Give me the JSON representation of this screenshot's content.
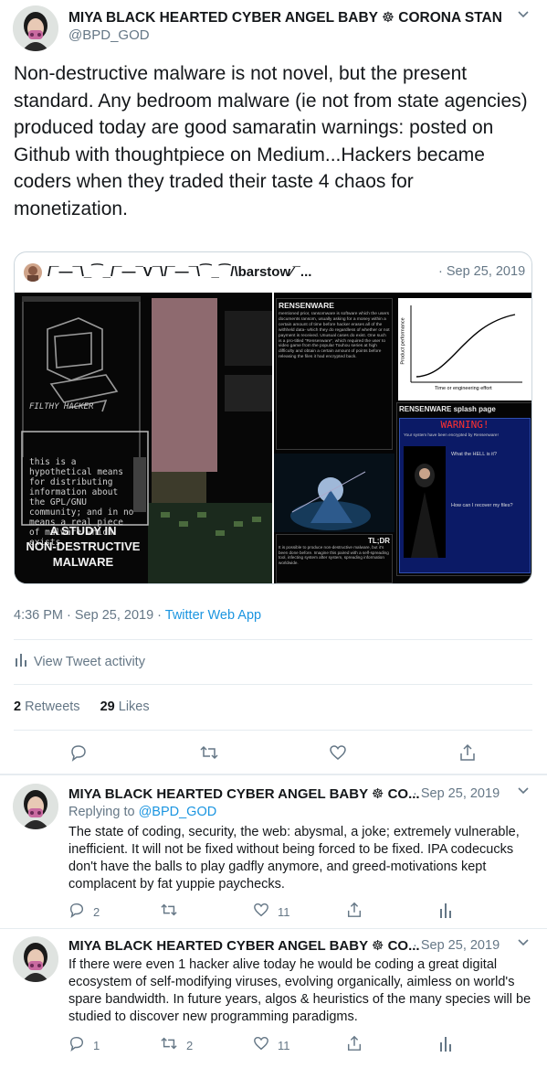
{
  "main_tweet": {
    "author_name": "MIYA BLACK HEARTED CYBER ANGEL BABY ☸ CORONA STAN",
    "author_handle": "@BPD_GOD",
    "text": "Non-destructive malware is not novel, but the present standard. Any bedroom malware (ie not from state agencies) produced today are good samaratin warnings: posted on Github with thoughtpiece on Medium...Hackers became coders when they traded their taste 4 chaos for monetization.",
    "quote": {
      "author_name": "/¯—¯\\_⁀_/¯—¯V¯\\/¯—¯\\⁀_⁀/\\barstow⁄¯...",
      "date": "· Sep 25, 2019",
      "left_image": {
        "label_filthy": "FILTHY HACKER",
        "paragraph": "this is a hypothetical means for distributing information about the GPL/GNU community; and in no means a real piece of malware which exists",
        "heading_line1": "A STUDY IN",
        "heading_line2": "NON-DESTRUCTIVE",
        "heading_line3": "MALWARE"
      },
      "right_image": {
        "section1_title": "RENSENWARE",
        "section1_body": "mentioned prior, ransomware is software which the users documents ransom, usually asking for a money within a certain amount of time before hacker erases all of the withheld data- which they do regardless of whether or not payment is received. Unusual cases do exist. One such is a pro-titled \"Rensenware\", which required the user to video game from the popular Touhou series at high difficulty and obtain a certain amount of points before releasing the files it had encrypted back.",
        "section2_title": "TL;DR",
        "section2_body": "It is possible to produce non-destructive malware, but it's been done before. Imagine this paired with a self-spreading tool, infecting system after system, spreading information worldwide.",
        "chart_caption": "Time or engineering effort",
        "chart_ylabel": "Product performance",
        "splash_title": "RENSENWARE splash page",
        "splash_warning": "WARNING!",
        "splash_line1": "Your system have been encrypted by Rensenware!",
        "splash_line2": "What the HELL is it?",
        "splash_line3": "How can I recover my files?"
      }
    },
    "timestamp": "4:36 PM · Sep 25, 2019 · ",
    "source": "Twitter Web App",
    "activity_label": "View Tweet activity",
    "retweets_count": "2",
    "retweets_label": "Retweets",
    "likes_count": "29",
    "likes_label": "Likes"
  },
  "replies": [
    {
      "author_name": "MIYA BLACK HEARTED CYBER ANGEL BABY ☸ CO...",
      "date": "· Sep 25, 2019",
      "replying_to_label": "Replying to ",
      "replying_to_handle": "@BPD_GOD",
      "text": "The state of coding, security, the web: abysmal, a joke; extremely vulnerable, inefficient. It will not be fixed without being forced to be fixed. IPA codecucks don't have the balls to play gadfly anymore, and greed-motivations kept complacent by fat yuppie paychecks.",
      "reply_count": "2",
      "retweet_count": "",
      "like_count": "11"
    },
    {
      "author_name": "MIYA BLACK HEARTED CYBER ANGEL BABY ☸ CO...",
      "date": "· Sep 25, 2019",
      "text": "If there were even 1 hacker alive today he would be coding a great digital ecosystem of self-modifying viruses, evolving organically, aimless on world's spare bandwidth. In future years, algos & heuristics of the many species will be studied to discover new programming paradigms.",
      "reply_count": "1",
      "retweet_count": "2",
      "like_count": "11"
    }
  ],
  "colors": {
    "accent": "#1b95e0",
    "muted": "#657786",
    "border": "#e6ecf0",
    "like_red": "#e0245e"
  }
}
